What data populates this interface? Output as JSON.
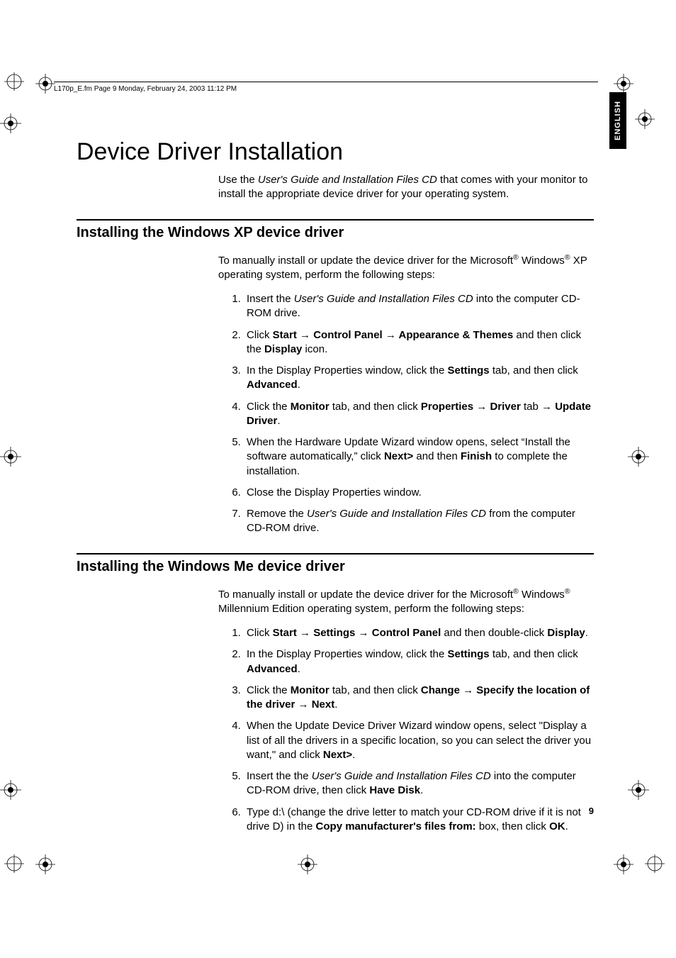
{
  "header": {
    "running_head": "L170p_E.fm  Page 9  Monday, February 24, 2003  11:12 PM"
  },
  "lang_tab": "ENGLISH",
  "title": "Device Driver Installation",
  "intro": {
    "pre": "Use the ",
    "cd": "User's Guide and Installation Files CD",
    "post": " that comes with your monitor to install the appropriate device driver for your operating system."
  },
  "xp": {
    "heading": "Installing the Windows XP device driver",
    "intro_pre": "To manually install or update the device driver for the Microsoft",
    "intro_mid": " Windows",
    "intro_post": " XP operating system, perform the following steps:",
    "s1_pre": "Insert the ",
    "s1_cd": "User's Guide and Installation Files CD",
    "s1_post": " into the computer CD-ROM drive.",
    "s2_a": "Click ",
    "s2_b": "Start",
    "s2_c": "Control Panel",
    "s2_d": "Appearance & Themes",
    "s2_e": " and then click the ",
    "s2_f": "Display",
    "s2_g": " icon.",
    "s3_a": "In the Display Properties window, click the ",
    "s3_b": "Settings",
    "s3_c": " tab, and then click ",
    "s3_d": "Advanced",
    "s3_e": ".",
    "s4_a": "Click the ",
    "s4_b": "Monitor",
    "s4_c": " tab, and then click ",
    "s4_d": "Properties",
    "s4_e": "Driver",
    "s4_f": " tab ",
    "s4_g": "Update Driver",
    "s4_h": ".",
    "s5_a": "When the Hardware Update Wizard window opens, select “Install the software automatically,” click ",
    "s5_b": "Next>",
    "s5_c": " and then ",
    "s5_d": "Finish",
    "s5_e": " to complete the installation.",
    "s6": "Close the Display Properties window.",
    "s7_a": "Remove the ",
    "s7_b": "User's Guide and Installation Files CD",
    "s7_c": " from the computer CD-ROM drive."
  },
  "me": {
    "heading": "Installing the Windows Me device driver",
    "intro_pre": "To manually install or update the device driver for the Microsoft",
    "intro_mid": " Windows",
    "intro_post": " Millennium Edition operating system, perform the following steps:",
    "s1_a": "Click ",
    "s1_b": "Start",
    "s1_c": "Settings",
    "s1_d": "Control Panel",
    "s1_e": " and then double-click ",
    "s1_f": "Display",
    "s1_g": ".",
    "s2_a": "In the Display Properties window, click the ",
    "s2_b": "Settings",
    "s2_c": " tab, and then click ",
    "s2_d": "Advanced",
    "s2_e": ".",
    "s3_a": "Click the ",
    "s3_b": "Monitor",
    "s3_c": " tab, and then click ",
    "s3_d": "Change",
    "s3_e": "Specify the location of the driver",
    "s3_f": "Next",
    "s3_g": ".",
    "s4_a": "When the Update Device Driver Wizard window opens, select   \"Display a list of all the drivers in a specific location, so you can select the driver you want,\" and click ",
    "s4_b": "Next>",
    "s4_c": ".",
    "s5_a": "Insert the the ",
    "s5_b": "User's Guide and Installation Files CD",
    "s5_c": " into the computer CD-ROM drive, then click ",
    "s5_d": "Have Disk",
    "s5_e": ".",
    "s6_a": "Type d:\\ (change the drive letter to match your CD-ROM drive if it is not drive D) in the ",
    "s6_b": "Copy manufacturer's files from:",
    "s6_c": " box, then click ",
    "s6_d": "OK",
    "s6_e": "."
  },
  "arrow": " → ",
  "reg": "®",
  "page_number": "9"
}
